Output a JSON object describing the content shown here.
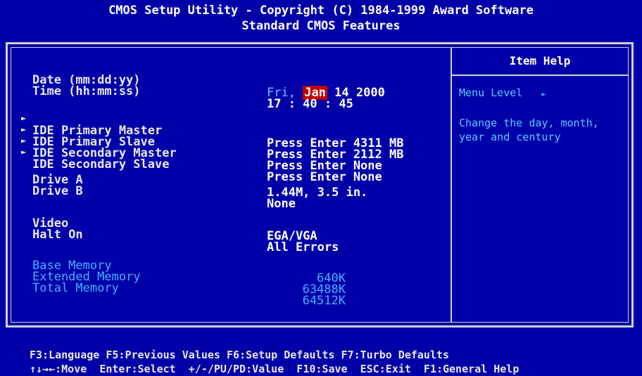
{
  "header": {
    "line1": "CMOS Setup Utility - Copyright (C) 1984-1999 Award Software",
    "line2": "Standard CMOS Features"
  },
  "help": {
    "title": "Item Help",
    "menu_level": "Menu Level",
    "menu_level_marker": "►",
    "description_line1": "Change the day, month,",
    "description_line2": "year and century"
  },
  "settings": {
    "date": {
      "label": "Date (mm:dd:yy)",
      "day": "Fri,",
      "month": "Jan",
      "rest": "14 2000"
    },
    "time": {
      "label": "Time (hh:mm:ss)",
      "value": "17 : 40 : 45"
    },
    "ide": [
      {
        "label": "IDE Primary Master",
        "value": "Press Enter 4311 MB"
      },
      {
        "label": "IDE Primary Slave",
        "value": "Press Enter 2112 MB"
      },
      {
        "label": "IDE Secondary Master",
        "value": "Press Enter None"
      },
      {
        "label": "IDE Secondary Slave",
        "value": "Press Enter None"
      }
    ],
    "drive_a": {
      "label": "Drive A",
      "value": "1.44M, 3.5 in."
    },
    "drive_b": {
      "label": "Drive B",
      "value": "None"
    },
    "video": {
      "label": "Video",
      "value": "EGA/VGA"
    },
    "halt_on": {
      "label": "Halt On",
      "value": "All Errors"
    },
    "memory": [
      {
        "label": "Base Memory",
        "value": "640K"
      },
      {
        "label": "Extended Memory",
        "value": "63488K"
      },
      {
        "label": "Total Memory",
        "value": "64512K"
      }
    ]
  },
  "footer": {
    "line1": "↑↓→←:Move  Enter:Select  +/-/PU/PD:Value  F10:Save  ESC:Exit  F1:General Help",
    "line2": "F3:Language F5:Previous Values F6:Setup Defaults F7:Turbo Defaults"
  },
  "colors": {
    "background": "#0000a8",
    "highlight": "#c80000",
    "help_text": "#5cc8ff"
  }
}
